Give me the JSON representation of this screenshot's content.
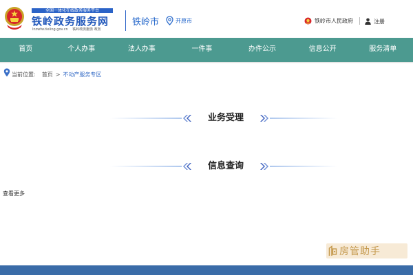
{
  "header": {
    "banner_text": "全国一体化在线政务服务平台",
    "site_name": "铁岭政务服务网",
    "site_domain": "lnzwfw.tieling.gov.cn",
    "site_slogan": "铁岭政务服务 政务",
    "city": "铁岭市",
    "switch_city_label": "开原市",
    "gov_link_label": "铁岭市人民政府",
    "register_label": "注册"
  },
  "nav": {
    "items": [
      {
        "label": "首页"
      },
      {
        "label": "个人办事"
      },
      {
        "label": "法人办事"
      },
      {
        "label": "一件事"
      },
      {
        "label": "办件公示"
      },
      {
        "label": "信息公开"
      },
      {
        "label": "服务清单"
      }
    ]
  },
  "breadcrumb": {
    "prefix": "当前位置:",
    "home": "首页",
    "separator": ">",
    "current": "不动产服务专区"
  },
  "sections": [
    {
      "title": "业务受理"
    },
    {
      "title": "信息查询"
    }
  ],
  "more_link": "查看更多",
  "watermark": {
    "text": "房管助手"
  },
  "colors": {
    "nav_bg": "#4c9a90",
    "brand_blue": "#2258bb",
    "link_blue": "#3a6fc7",
    "footer_bg": "#3a6ca8"
  }
}
